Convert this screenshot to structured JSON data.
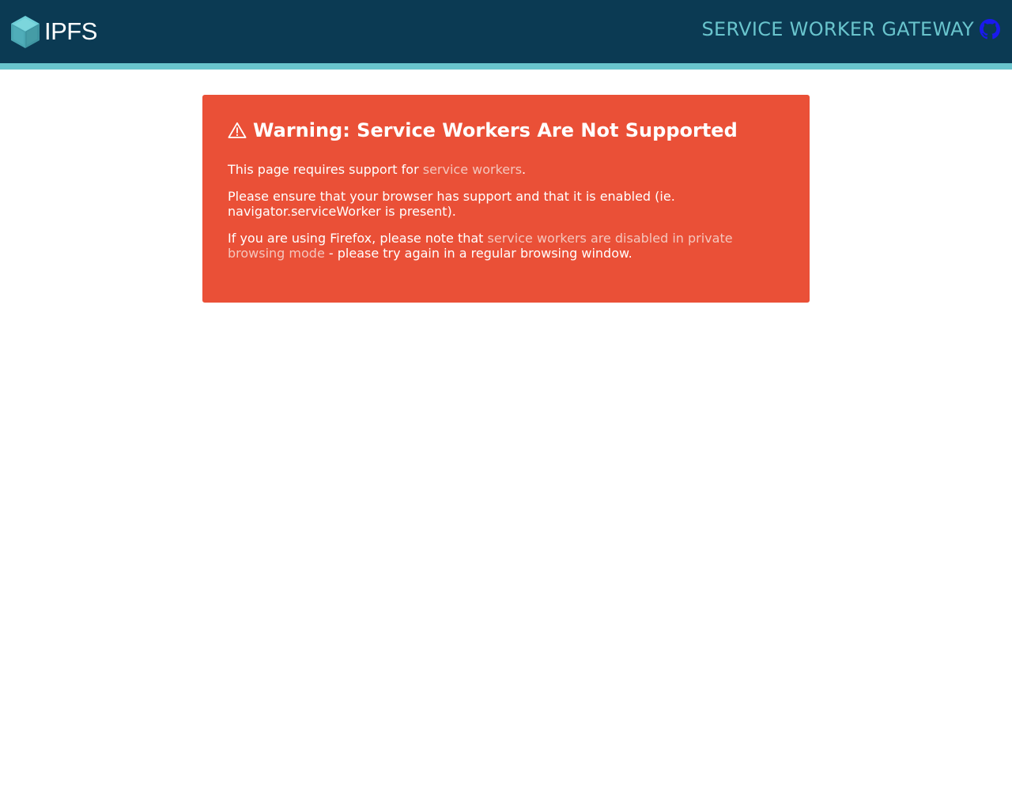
{
  "header": {
    "logo_text": "IPFS",
    "title": "SERVICE WORKER GATEWAY",
    "github_icon": "github-icon",
    "colors": {
      "background": "#0b3a53",
      "accent": "#69c4cd",
      "github_icon": "#1a1aee"
    }
  },
  "warning": {
    "icon": "warning-triangle-icon",
    "title": "Warning: Service Workers Are Not Supported",
    "p1": {
      "before": "This page requires support for ",
      "link": "service workers",
      "after": "."
    },
    "p2": "Please ensure that your browser has support and that it is enabled (ie. navigator.serviceWorker is present).",
    "p3": {
      "before": "If you are using Firefox, please note that ",
      "link": "service workers are disabled in private browsing mode",
      "after": " - please try again in a regular browsing window."
    },
    "colors": {
      "background": "#ea5037",
      "text": "#ffffff",
      "link": "#f4c6bd"
    }
  }
}
